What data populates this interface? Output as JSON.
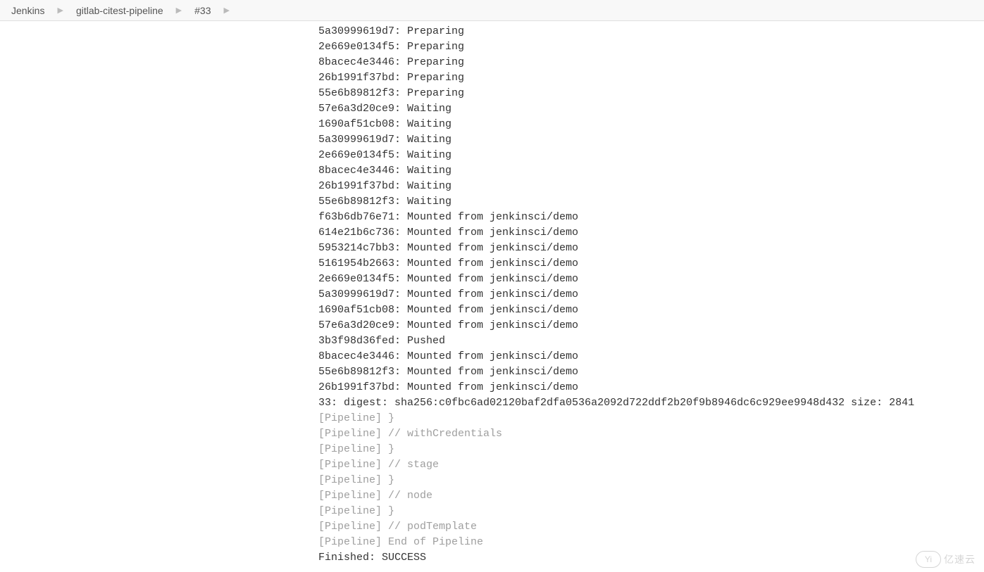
{
  "breadcrumb": {
    "items": [
      {
        "label": "Jenkins"
      },
      {
        "label": "gitlab-citest-pipeline"
      },
      {
        "label": "#33"
      }
    ]
  },
  "console": {
    "lines": [
      {
        "text": "5a30999619d7: Preparing",
        "gray": false
      },
      {
        "text": "2e669e0134f5: Preparing",
        "gray": false
      },
      {
        "text": "8bacec4e3446: Preparing",
        "gray": false
      },
      {
        "text": "26b1991f37bd: Preparing",
        "gray": false
      },
      {
        "text": "55e6b89812f3: Preparing",
        "gray": false
      },
      {
        "text": "57e6a3d20ce9: Waiting",
        "gray": false
      },
      {
        "text": "1690af51cb08: Waiting",
        "gray": false
      },
      {
        "text": "5a30999619d7: Waiting",
        "gray": false
      },
      {
        "text": "2e669e0134f5: Waiting",
        "gray": false
      },
      {
        "text": "8bacec4e3446: Waiting",
        "gray": false
      },
      {
        "text": "26b1991f37bd: Waiting",
        "gray": false
      },
      {
        "text": "55e6b89812f3: Waiting",
        "gray": false
      },
      {
        "text": "f63b6db76e71: Mounted from jenkinsci/demo",
        "gray": false
      },
      {
        "text": "614e21b6c736: Mounted from jenkinsci/demo",
        "gray": false
      },
      {
        "text": "5953214c7bb3: Mounted from jenkinsci/demo",
        "gray": false
      },
      {
        "text": "5161954b2663: Mounted from jenkinsci/demo",
        "gray": false
      },
      {
        "text": "2e669e0134f5: Mounted from jenkinsci/demo",
        "gray": false
      },
      {
        "text": "5a30999619d7: Mounted from jenkinsci/demo",
        "gray": false
      },
      {
        "text": "1690af51cb08: Mounted from jenkinsci/demo",
        "gray": false
      },
      {
        "text": "57e6a3d20ce9: Mounted from jenkinsci/demo",
        "gray": false
      },
      {
        "text": "3b3f98d36fed: Pushed",
        "gray": false
      },
      {
        "text": "8bacec4e3446: Mounted from jenkinsci/demo",
        "gray": false
      },
      {
        "text": "55e6b89812f3: Mounted from jenkinsci/demo",
        "gray": false
      },
      {
        "text": "26b1991f37bd: Mounted from jenkinsci/demo",
        "gray": false
      },
      {
        "text": "33: digest: sha256:c0fbc6ad02120baf2dfa0536a2092d722ddf2b20f9b8946dc6c929ee9948d432 size: 2841",
        "gray": false
      },
      {
        "text": "[Pipeline] }",
        "gray": true
      },
      {
        "text": "[Pipeline] // withCredentials",
        "gray": true
      },
      {
        "text": "[Pipeline] }",
        "gray": true
      },
      {
        "text": "[Pipeline] // stage",
        "gray": true
      },
      {
        "text": "[Pipeline] }",
        "gray": true
      },
      {
        "text": "[Pipeline] // node",
        "gray": true
      },
      {
        "text": "[Pipeline] }",
        "gray": true
      },
      {
        "text": "[Pipeline] // podTemplate",
        "gray": true
      },
      {
        "text": "[Pipeline] End of Pipeline",
        "gray": true
      },
      {
        "text": "Finished: SUCCESS",
        "gray": false
      }
    ]
  },
  "watermark": {
    "icon_text": "Yi",
    "text": "亿速云"
  }
}
